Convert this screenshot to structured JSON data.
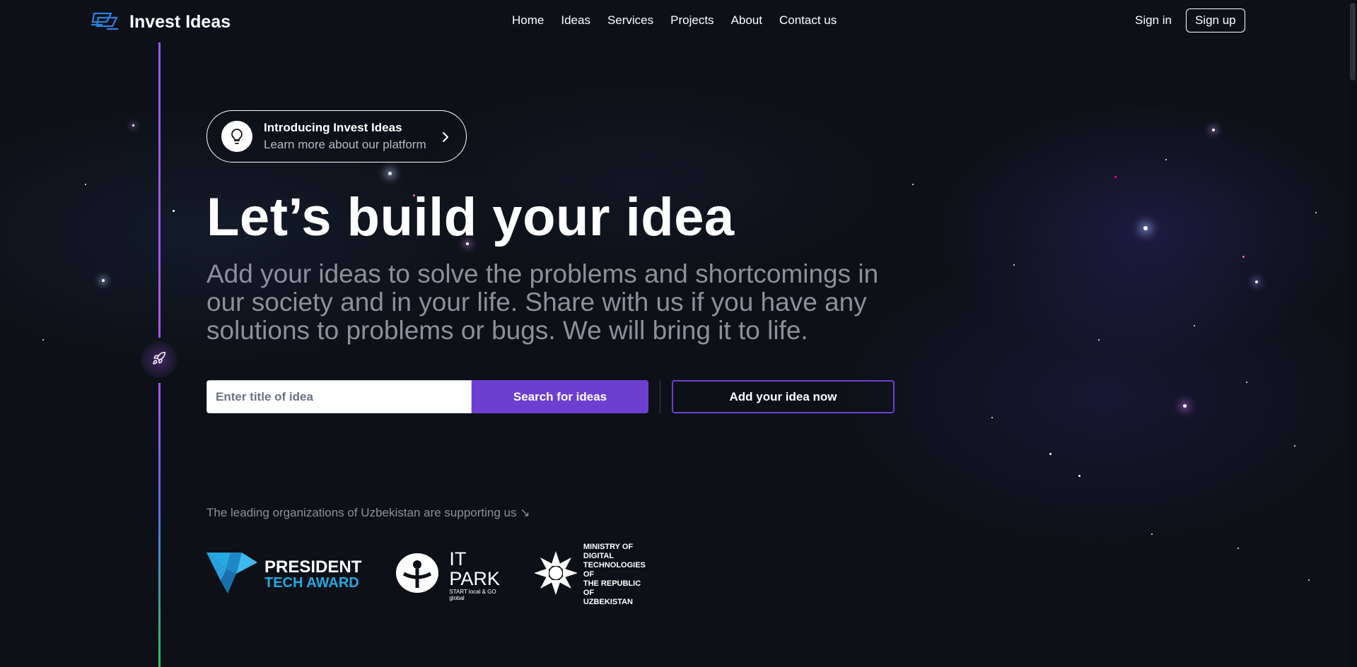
{
  "brand": {
    "name": "Invest Ideas"
  },
  "nav": [
    "Home",
    "Ideas",
    "Services",
    "Projects",
    "About",
    "Contact us"
  ],
  "auth": {
    "sign_in": "Sign in",
    "sign_up": "Sign up"
  },
  "intro": {
    "title": "Introducing Invest Ideas",
    "subtitle": "Learn more about our platform"
  },
  "hero": {
    "title": "Let’s build your idea",
    "lead": "Add your ideas to solve the problems and shortcomings in our society and in your life. Share with us if you have any solutions to problems or bugs. We will bring it to life."
  },
  "search": {
    "placeholder": "Enter title of idea",
    "button": "Search for ideas",
    "add_button": "Add your idea now"
  },
  "supporting": {
    "text": "The leading organizations of Uzbekistan are supporting us ↘"
  },
  "partners": {
    "pta": {
      "line1": "PRESIDENT",
      "line2": "TECH AWARD"
    },
    "itpark": {
      "title": "IT PARK",
      "tagline": "START local & GO global"
    },
    "ministry": {
      "line1": "MINISTRY OF",
      "line2": "DIGITAL TECHNOLOGIES OF",
      "line3": "THE REPUBLIC OF UZBEKISTAN"
    }
  },
  "colors": {
    "accent": "#6d3fd0",
    "background": "#0d1117",
    "pta_blue": "#27a8e0"
  }
}
